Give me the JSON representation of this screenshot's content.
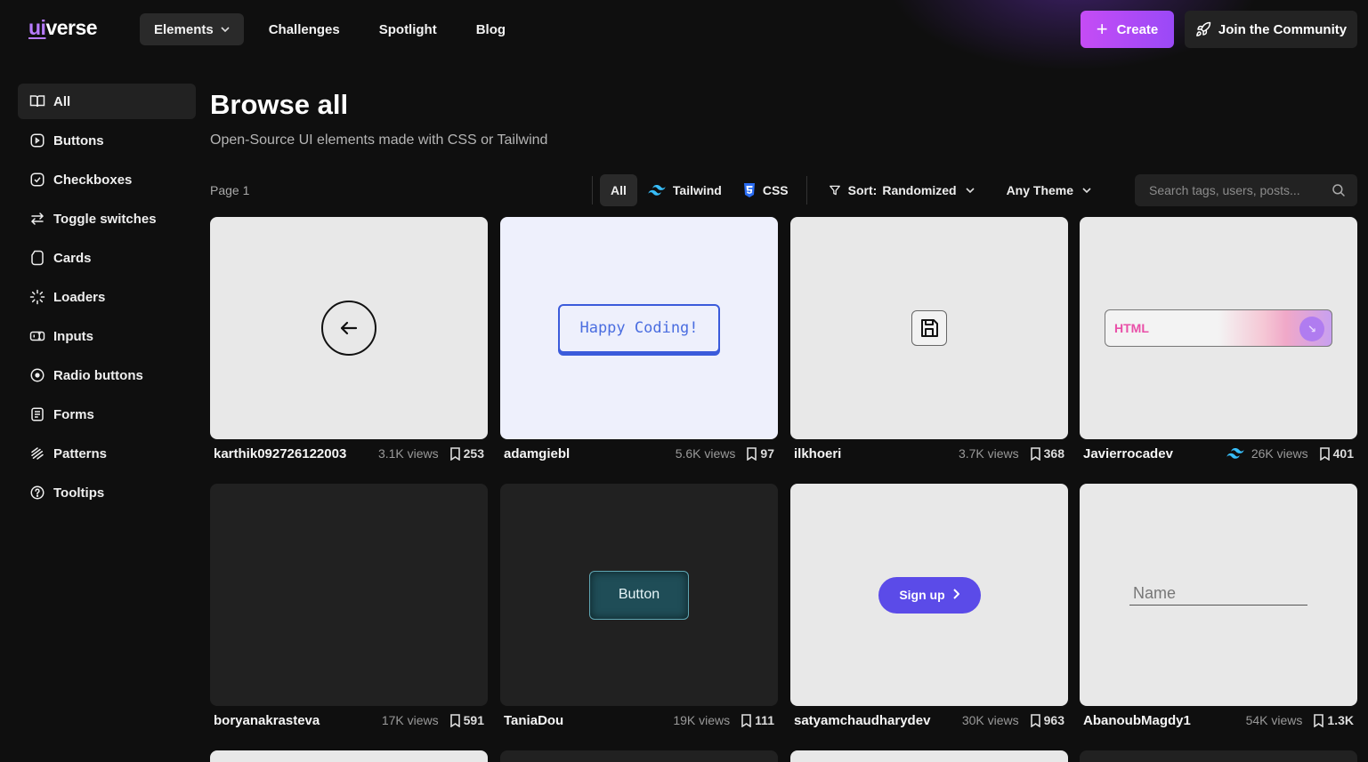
{
  "header": {
    "logo_ui": "ui",
    "logo_rest": "verse",
    "nav": [
      {
        "label": "Elements",
        "dropdown": true
      },
      {
        "label": "Challenges"
      },
      {
        "label": "Spotlight"
      },
      {
        "label": "Blog"
      }
    ],
    "create_label": "Create",
    "community_label": "Join the Community",
    "accent": "#b77bff"
  },
  "sidebar": {
    "items": [
      {
        "label": "All",
        "icon": "book-icon",
        "active": true
      },
      {
        "label": "Buttons",
        "icon": "button-icon"
      },
      {
        "label": "Checkboxes",
        "icon": "checkbox-icon"
      },
      {
        "label": "Toggle switches",
        "icon": "toggle-icon"
      },
      {
        "label": "Cards",
        "icon": "card-icon"
      },
      {
        "label": "Loaders",
        "icon": "loader-icon"
      },
      {
        "label": "Inputs",
        "icon": "input-icon"
      },
      {
        "label": "Radio buttons",
        "icon": "radio-icon"
      },
      {
        "label": "Forms",
        "icon": "form-icon"
      },
      {
        "label": "Patterns",
        "icon": "pattern-icon"
      },
      {
        "label": "Tooltips",
        "icon": "tooltip-icon"
      }
    ]
  },
  "main": {
    "title": "Browse all",
    "subtitle": "Open-Source UI elements made with CSS or Tailwind",
    "page_label": "Page 1",
    "filters": {
      "all": "All",
      "tailwind": "Tailwind",
      "css": "CSS",
      "sort_label": "Sort:",
      "sort_value": "Randomized",
      "theme": "Any Theme"
    },
    "search_placeholder": "Search tags, users, posts..."
  },
  "cards": [
    {
      "user": "karthik092726122003",
      "views": "3.1K views",
      "saves": "253",
      "preview": "back-arrow-button"
    },
    {
      "user": "adamgiebl",
      "views": "5.6K views",
      "saves": "97",
      "preview_text": "Happy Coding!"
    },
    {
      "user": "ilkhoeri",
      "views": "3.7K views",
      "saves": "368",
      "preview": "save-icon-button"
    },
    {
      "user": "Javierrocadev",
      "views": "26K views",
      "saves": "401",
      "tailwind": true,
      "preview_text": "HTML"
    },
    {
      "user": "boryanakrasteva",
      "views": "17K views",
      "saves": "591",
      "preview": "empty"
    },
    {
      "user": "TaniaDou",
      "views": "19K views",
      "saves": "111",
      "preview_text": "Button"
    },
    {
      "user": "satyamchaudharydev",
      "views": "30K views",
      "saves": "963",
      "preview_text": "Sign up"
    },
    {
      "user": "AbanoubMagdy1",
      "views": "54K views",
      "saves": "1.3K",
      "preview_placeholder": "Name"
    }
  ]
}
